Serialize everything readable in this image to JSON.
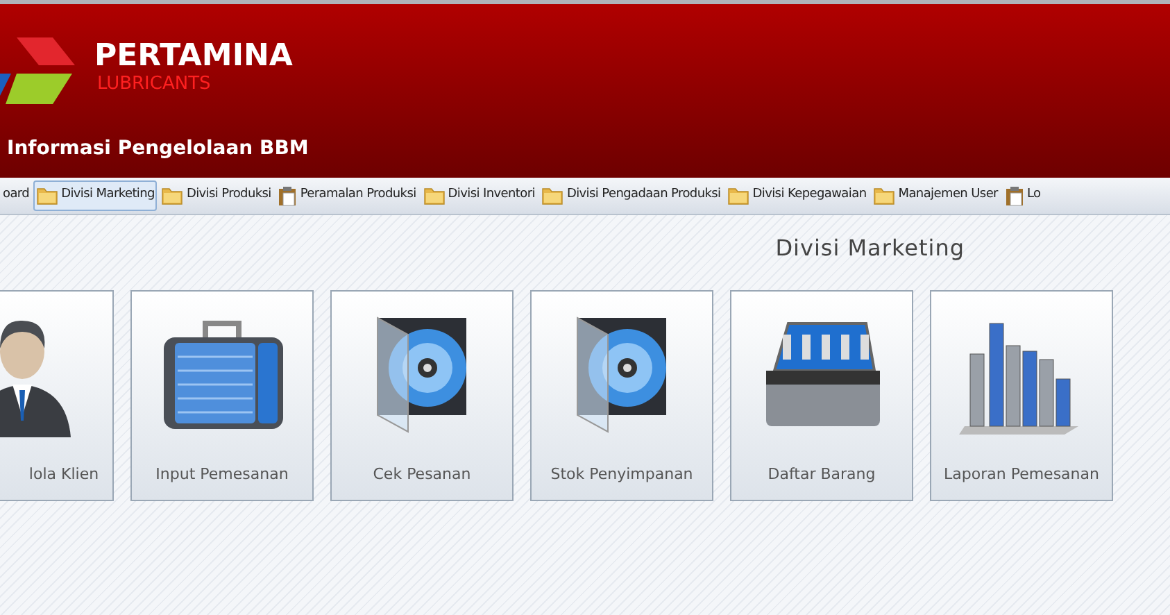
{
  "header": {
    "brand": "PERTAMINA",
    "sub_brand": "LUBRICANTS",
    "title": "Informasi Pengelolaan BBM"
  },
  "menu": [
    {
      "label": "oard",
      "selected": false
    },
    {
      "label": "Divisi Marketing",
      "selected": true
    },
    {
      "label": "Divisi Produksi",
      "selected": false
    },
    {
      "label": "Peramalan Produksi",
      "selected": false
    },
    {
      "label": "Divisi Inventori",
      "selected": false
    },
    {
      "label": "Divisi Pengadaan Produksi",
      "selected": false
    },
    {
      "label": "Divisi Kepegawaian",
      "selected": false
    },
    {
      "label": "Manajemen User",
      "selected": false
    },
    {
      "label": "Lo",
      "selected": false
    }
  ],
  "page_title": "Divisi Marketing",
  "tiles": [
    {
      "kind": "person",
      "label": "lola Klien"
    },
    {
      "kind": "briefcase",
      "label": "Input Pemesanan"
    },
    {
      "kind": "disc",
      "label": "Cek Pesanan"
    },
    {
      "kind": "disc",
      "label": "Stok Penyimpanan"
    },
    {
      "kind": "toolbox",
      "label": "Daftar Barang"
    },
    {
      "kind": "chart",
      "label": "Laporan Pemesanan"
    }
  ]
}
